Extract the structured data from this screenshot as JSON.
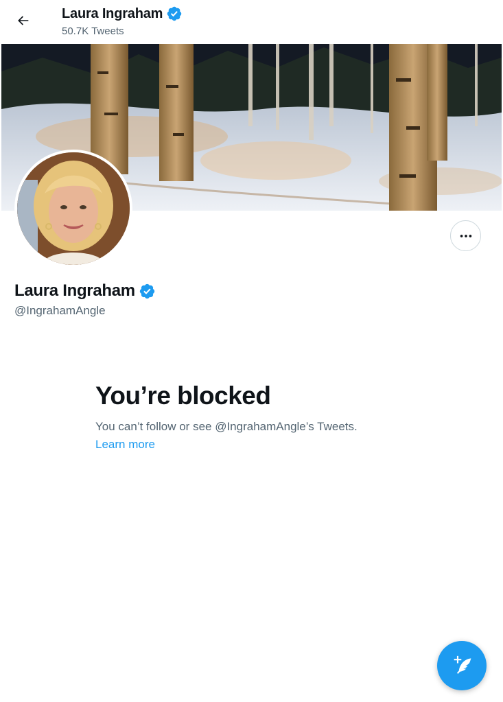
{
  "header": {
    "title": "Laura Ingraham",
    "tweet_count": "50.7K Tweets"
  },
  "profile": {
    "name": "Laura Ingraham",
    "handle": "@IngrahamAngle",
    "verified": true
  },
  "blocked": {
    "title": "You’re blocked",
    "message": "You can’t follow or see @IngrahamAngle’s Tweets.",
    "link": "Learn more"
  },
  "icons": {
    "back": "arrow-left-icon",
    "verified": "verified-badge-icon",
    "more": "more-horizontal-icon",
    "compose": "compose-tweet-icon"
  },
  "colors": {
    "accent": "#1d9bf0",
    "text_primary": "#0f1419",
    "text_secondary": "#536471",
    "border": "#cfd9de"
  }
}
